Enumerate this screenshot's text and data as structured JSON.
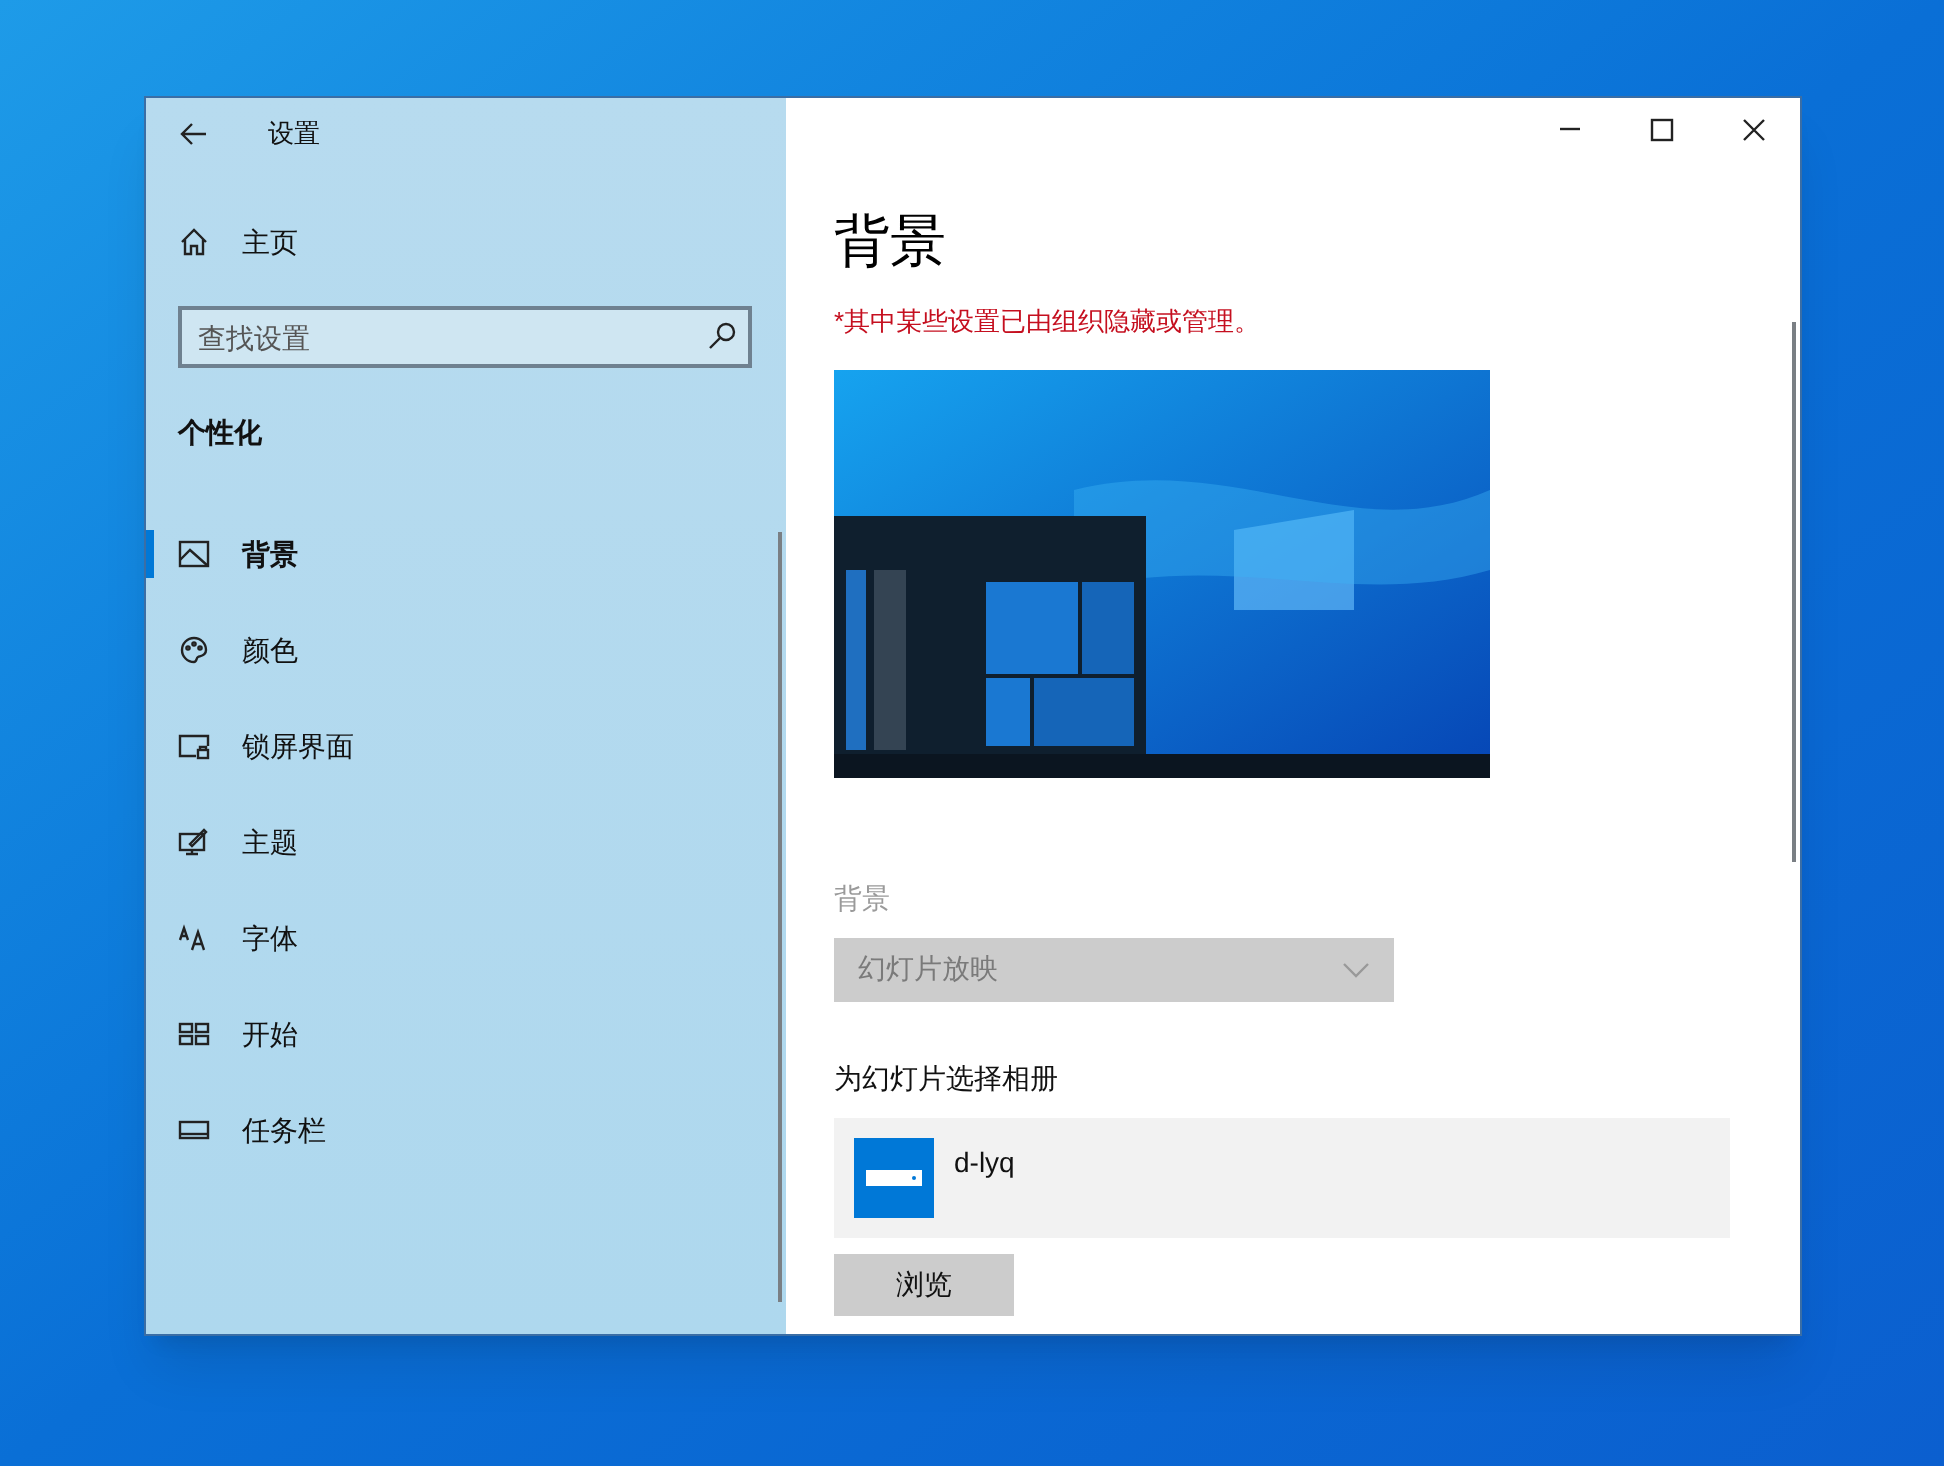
{
  "window": {
    "title": "设置"
  },
  "sidebar": {
    "home": "主页",
    "search": {
      "placeholder": "查找设置"
    },
    "section": "个性化",
    "items": [
      {
        "label": "背景",
        "selected": true
      },
      {
        "label": "颜色",
        "selected": false
      },
      {
        "label": "锁屏界面",
        "selected": false
      },
      {
        "label": "主题",
        "selected": false
      },
      {
        "label": "字体",
        "selected": false
      },
      {
        "label": "开始",
        "selected": false
      },
      {
        "label": "任务栏",
        "selected": false
      }
    ]
  },
  "content": {
    "heading": "背景",
    "notice": "*其中某些设置已由组织隐藏或管理。",
    "background_label": "背景",
    "background_dropdown": {
      "value": "幻灯片放映",
      "disabled": true
    },
    "album_label": "为幻灯片选择相册",
    "album": {
      "name": "d-lyq"
    },
    "browse_button": "浏览"
  }
}
